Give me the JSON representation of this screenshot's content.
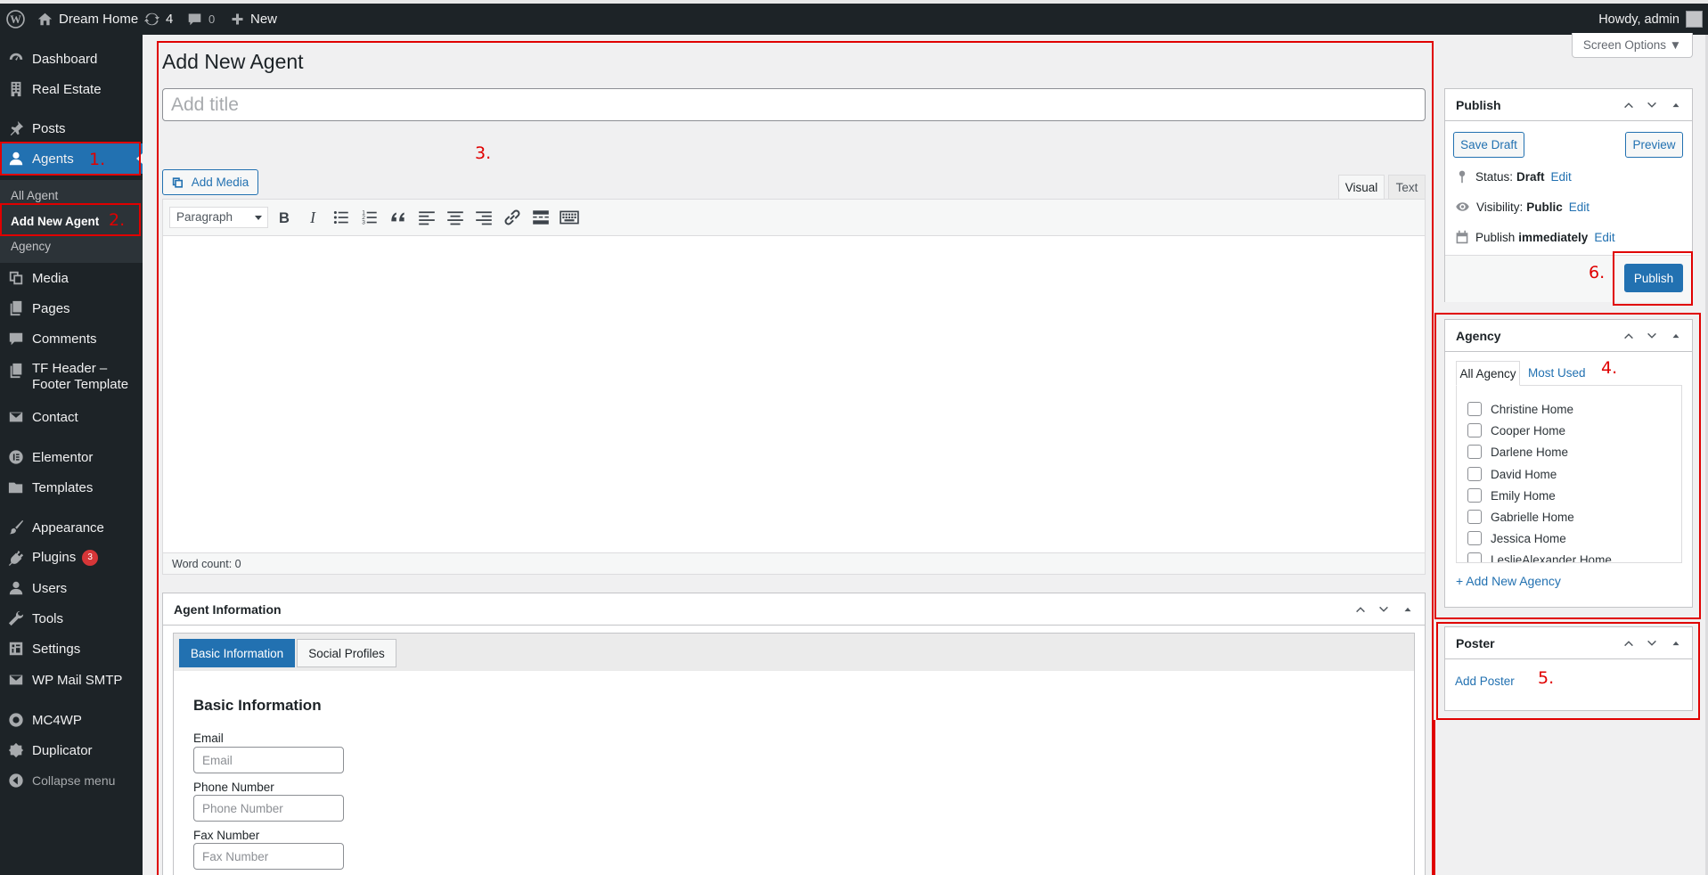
{
  "adminbar": {
    "site_name": "Dream Home",
    "updates_count": "4",
    "comments_count": "0",
    "new_label": "New",
    "howdy": "Howdy, admin"
  },
  "sidebar": {
    "items": [
      {
        "label": "Dashboard",
        "icon": "dashboard-icon"
      },
      {
        "label": "Real Estate",
        "icon": "building-icon"
      },
      {
        "label": "Posts",
        "icon": "pin-icon"
      },
      {
        "label": "Agents",
        "icon": "user-icon"
      },
      {
        "label": "Media",
        "icon": "media-icon"
      },
      {
        "label": "Pages",
        "icon": "pages-icon"
      },
      {
        "label": "Comments",
        "icon": "comments-icon"
      },
      {
        "label": "TF Header –",
        "label2": "Footer Template",
        "icon": "pages-icon"
      },
      {
        "label": "Contact",
        "icon": "mail-icon"
      },
      {
        "label": "Elementor",
        "icon": "elementor-icon"
      },
      {
        "label": "Templates",
        "icon": "folder-icon"
      },
      {
        "label": "Appearance",
        "icon": "brush-icon"
      },
      {
        "label": "Plugins",
        "icon": "plugin-icon",
        "badge": "3"
      },
      {
        "label": "Users",
        "icon": "users-icon"
      },
      {
        "label": "Tools",
        "icon": "wrench-icon"
      },
      {
        "label": "Settings",
        "icon": "settings-icon"
      },
      {
        "label": "WP Mail SMTP",
        "icon": "mail-icon"
      },
      {
        "label": "MC4WP",
        "icon": "mc4wp-icon"
      },
      {
        "label": "Duplicator",
        "icon": "duplicator-icon"
      },
      {
        "label": "Collapse menu",
        "icon": "collapse-icon"
      }
    ],
    "submenu": [
      "All Agent",
      "Add New Agent",
      "Agency"
    ]
  },
  "screen_options": "Screen Options ▼",
  "page": {
    "title": "Add New Agent",
    "title_placeholder": "Add title"
  },
  "editor": {
    "add_media": "Add Media",
    "tab_visual": "Visual",
    "tab_text": "Text",
    "format": "Paragraph",
    "word_count": "Word count: 0"
  },
  "agent_info": {
    "box_title": "Agent Information",
    "tabs": [
      "Basic Information",
      "Social Profiles"
    ],
    "section_title": "Basic Information",
    "fields": [
      {
        "label": "Email",
        "placeholder": "Email"
      },
      {
        "label": "Phone Number",
        "placeholder": "Phone Number"
      },
      {
        "label": "Fax Number",
        "placeholder": "Fax Number"
      }
    ]
  },
  "publish": {
    "title": "Publish",
    "save_draft": "Save Draft",
    "preview": "Preview",
    "status_label": "Status:",
    "status_value": "Draft",
    "visibility_label": "Visibility:",
    "visibility_value": "Public",
    "publish_label": "Publish",
    "publish_value": "immediately",
    "edit": "Edit",
    "publish_button": "Publish"
  },
  "agency": {
    "title": "Agency",
    "tabs": [
      "All Agency",
      "Most Used"
    ],
    "items": [
      "Christine Home",
      "Cooper Home",
      "Darlene Home",
      "David Home",
      "Emily Home",
      "Gabrielle Home",
      "Jessica Home",
      "LeslieAlexander Home"
    ],
    "add_new": "+ Add New Agency"
  },
  "poster": {
    "title": "Poster",
    "add": "Add Poster"
  },
  "annotations": [
    "1.",
    "2.",
    "3.",
    "4.",
    "5.",
    "6."
  ],
  "colors": {
    "admin_bar": "#1d2327",
    "accent": "#2271b1",
    "annotation_red": "#e00000",
    "badge_red": "#d63638"
  }
}
